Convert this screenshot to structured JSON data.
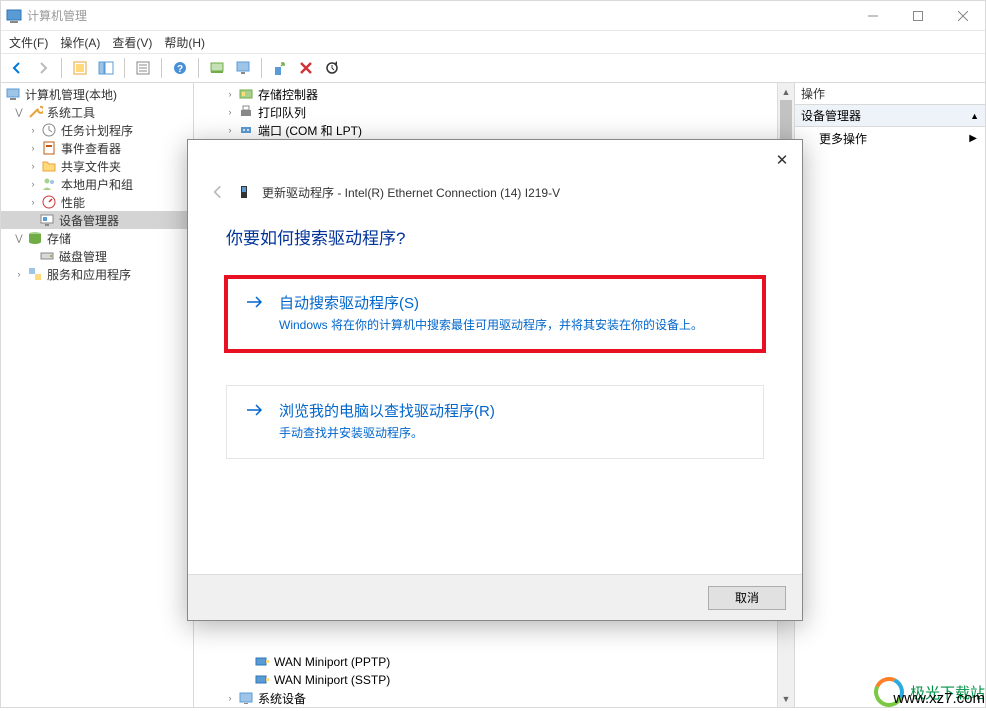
{
  "titlebar": {
    "title": "计算机管理"
  },
  "menubar": {
    "file": "文件(F)",
    "action": "操作(A)",
    "view": "查看(V)",
    "help": "帮助(H)"
  },
  "tree": {
    "root": "计算机管理(本地)",
    "sys_tools": "系统工具",
    "task_scheduler": "任务计划程序",
    "event_viewer": "事件查看器",
    "shared_folders": "共享文件夹",
    "local_users": "本地用户和组",
    "performance": "性能",
    "device_manager": "设备管理器",
    "storage": "存储",
    "disk_mgmt": "磁盘管理",
    "services_apps": "服务和应用程序"
  },
  "devices": {
    "storage_ctrl": "存储控制器",
    "print_queue": "打印队列",
    "ports": "端口 (COM 和 LPT)",
    "wan_pptp": "WAN Miniport (PPTP)",
    "wan_sstp": "WAN Miniport (SSTP)",
    "system_devices": "系统设备"
  },
  "actions": {
    "header": "操作",
    "section": "设备管理器",
    "more": "更多操作"
  },
  "dialog": {
    "title": "更新驱动程序 - Intel(R) Ethernet Connection (14) I219-V",
    "heading": "你要如何搜索驱动程序?",
    "opt1_title": "自动搜索驱动程序(S)",
    "opt1_desc": "Windows 将在你的计算机中搜索最佳可用驱动程序，并将其安装在你的设备上。",
    "opt2_title": "浏览我的电脑以查找驱动程序(R)",
    "opt2_desc": "手动查找并安装驱动程序。",
    "cancel": "取消"
  },
  "watermark": {
    "name": "极光下载站",
    "url": "www.xz7.com"
  }
}
